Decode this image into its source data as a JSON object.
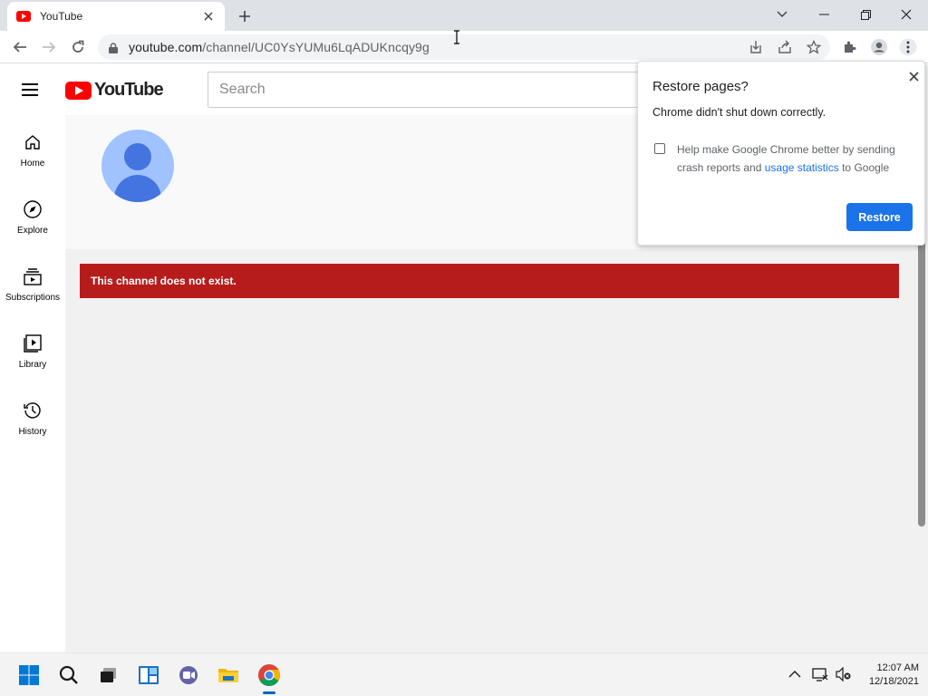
{
  "browser": {
    "tab": {
      "title": "YouTube",
      "favicon": "youtube-favicon-icon"
    },
    "url": {
      "host": "youtube.com",
      "path": "/channel/UC0YsYUMu6LqADUKncqy9g"
    }
  },
  "youtube": {
    "logo_text": "YouTube",
    "search_placeholder": "Search",
    "sidebar": [
      {
        "label": "Home",
        "icon": "home-icon"
      },
      {
        "label": "Explore",
        "icon": "compass-icon"
      },
      {
        "label": "Subscriptions",
        "icon": "subscriptions-icon"
      },
      {
        "label": "Library",
        "icon": "library-icon"
      },
      {
        "label": "History",
        "icon": "history-icon"
      }
    ],
    "error_message": "This channel does not exist."
  },
  "popup": {
    "title": "Restore pages?",
    "message": "Chrome didn't shut down correctly.",
    "checkbox_text_before": "Help make Google Chrome better by sending crash reports and ",
    "checkbox_link": "usage statistics",
    "checkbox_text_after": " to Google",
    "checkbox_checked": false,
    "restore_label": "Restore"
  },
  "taskbar": {
    "time": "12:07 AM",
    "date": "12/18/2021"
  },
  "colors": {
    "error_red": "#b71c1c",
    "chrome_blue": "#1a73e8",
    "youtube_red": "#ff0000"
  }
}
